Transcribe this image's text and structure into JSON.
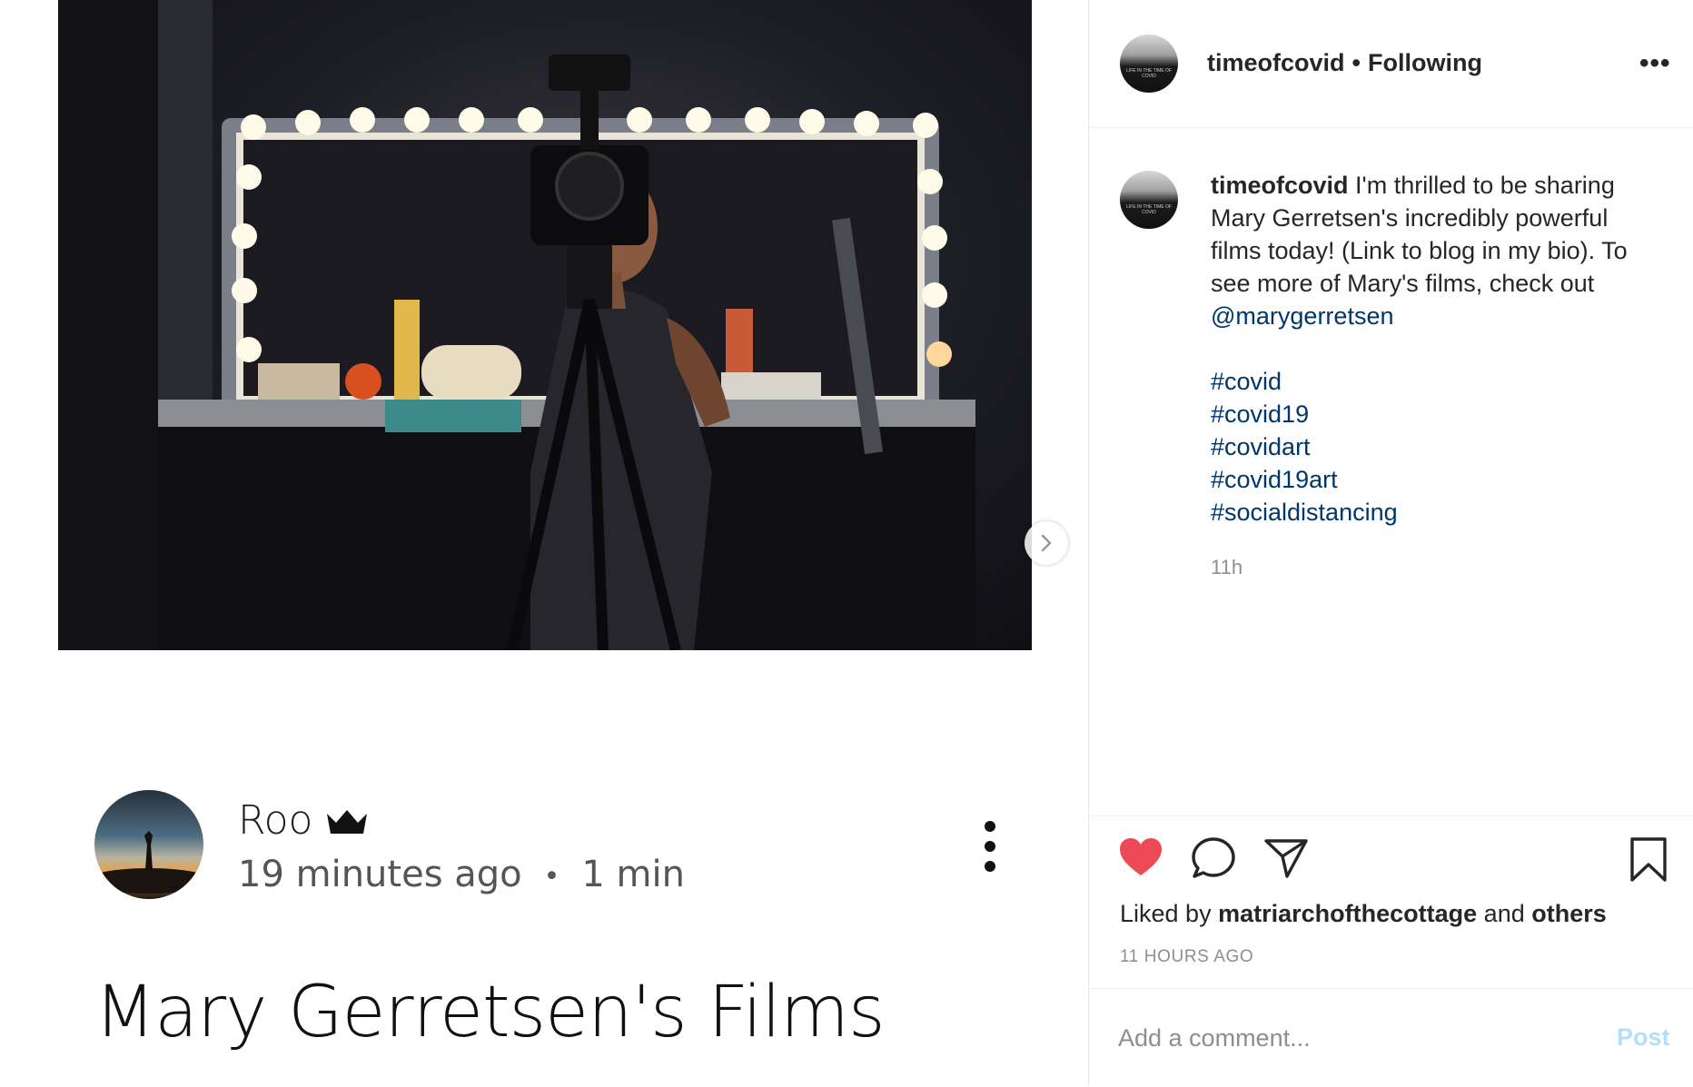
{
  "post": {
    "username": "timeofcovid",
    "separator": "•",
    "follow_status": "Following",
    "more_icon": "•••",
    "avatar_text": "LIFE IN THE TIME OF COVID",
    "caption_text": "I'm thrilled to be sharing Mary Gerretsen's incredibly powerful films today! (Link to blog in my bio). To see more of Mary's films, check out",
    "mention": "@marygerretsen",
    "hashtags": [
      "#covid",
      "#covid19",
      "#covidart",
      "#covid19art",
      "#socialdistancing"
    ],
    "time": "11h",
    "liked_prefix": "Liked by",
    "liked_user": "matriarchofthecottage",
    "liked_and": "and",
    "liked_others": "others",
    "timestamp": "11 HOURS AGO",
    "comment_placeholder": "Add a comment...",
    "post_button": "Post",
    "like_color": "#ed4956",
    "link_color": "#00376b"
  },
  "blog": {
    "author": "Roo",
    "time_ago": "19 minutes ago",
    "dot": "•",
    "read_time": "1 min",
    "title": "Mary Gerretsen's Films"
  },
  "icons": {
    "like": "heart-icon",
    "comment": "speech-bubble-icon",
    "share": "paper-plane-icon",
    "save": "bookmark-icon",
    "next": "chevron-right-icon",
    "crown": "crown-icon",
    "options": "kebab-icon"
  }
}
